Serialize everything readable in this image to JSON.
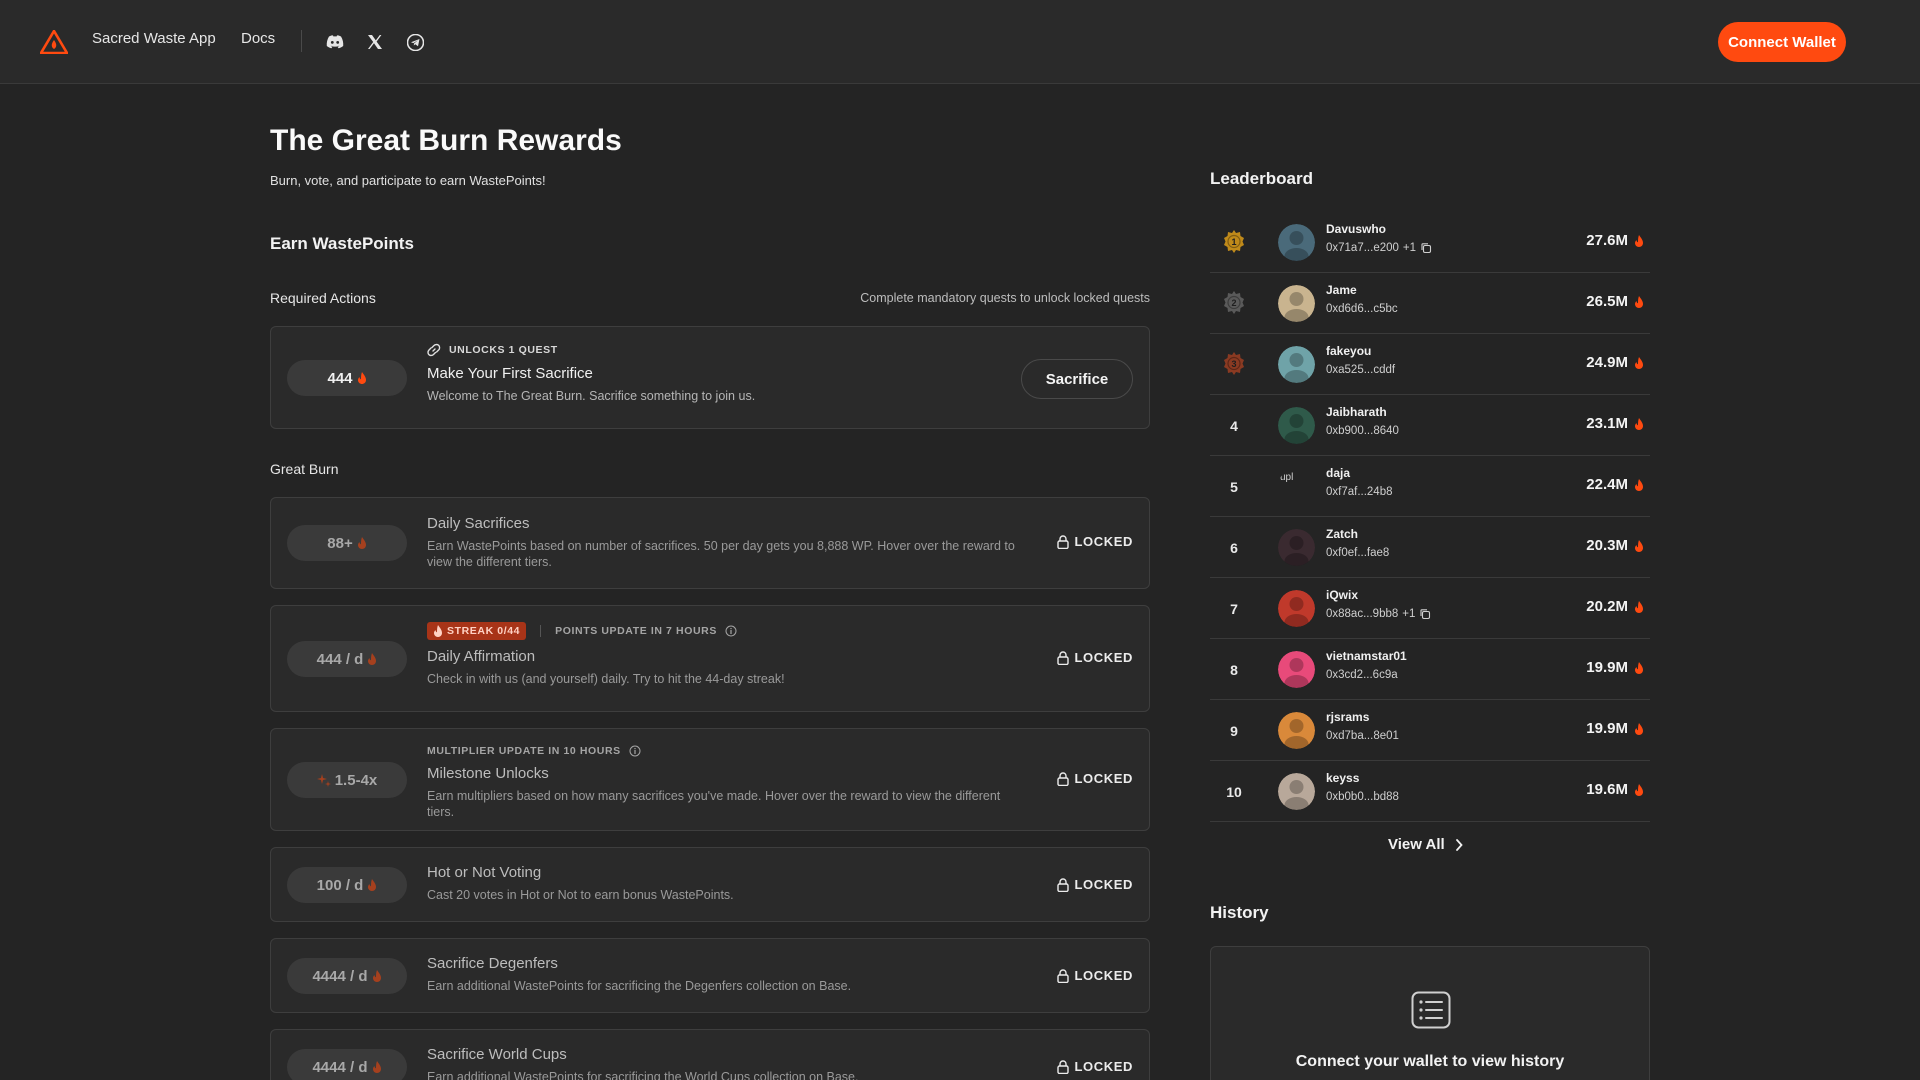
{
  "header": {
    "app_link": "Sacred Waste App",
    "docs_link": "Docs",
    "connect_label": "Connect Wallet",
    "accent": "#ff4a10"
  },
  "main": {
    "title": "The Great Burn Rewards",
    "subtitle": "Burn, vote, and participate to earn WastePoints!",
    "section_title": "Earn WastePoints",
    "required": {
      "label": "Required Actions",
      "note": "Complete mandatory quests to unlock locked quests",
      "quest": {
        "reward": "444",
        "unlocks": "UNLOCKS 1 QUEST",
        "title": "Make Your First Sacrifice",
        "desc": "Welcome to The Great Burn. Sacrifice something to join us.",
        "button": "Sacrifice"
      }
    },
    "great_burn": {
      "label": "Great Burn",
      "locked_label": "LOCKED",
      "quests": [
        {
          "reward": "88+",
          "title": "Daily Sacrifices",
          "desc": "Earn WastePoints based on number of sacrifices. 50 per day gets you 8,888 WP. Hover over the reward to view the different tiers."
        },
        {
          "reward": "444 / d",
          "streak": "STREAK 0/44",
          "update": "POINTS UPDATE IN 7 HOURS",
          "title": "Daily Affirmation",
          "desc": "Check in with us (and yourself) daily. Try to hit the 44-day streak!"
        },
        {
          "reward": "1.5-4x",
          "update": "MULTIPLIER UPDATE IN 10 HOURS",
          "title": "Milestone Unlocks",
          "desc": "Earn multipliers based on how many sacrifices you've made. Hover over the reward to view the different tiers."
        },
        {
          "reward": "100 / d",
          "title": "Hot or Not Voting",
          "desc": "Cast 20 votes in Hot or Not to earn bonus WastePoints."
        },
        {
          "reward": "4444 / d",
          "title": "Sacrifice Degenfers",
          "desc": "Earn additional WastePoints for sacrificing the Degenfers collection on Base."
        },
        {
          "reward": "4444 / d",
          "title": "Sacrifice World Cups",
          "desc": "Earn additional WastePoints for sacrificing the World Cups collection on Base."
        }
      ]
    }
  },
  "leaderboard": {
    "title": "Leaderboard",
    "view_all": "View All",
    "rows": [
      {
        "rank": "1",
        "name": "Davuswho",
        "addr": "0x71a7...e200",
        "extra": "+1",
        "score": "27.6M",
        "avatar_color": "#4a6a7a"
      },
      {
        "rank": "2",
        "name": "Jame",
        "addr": "0xd6d6...c5bc",
        "extra": "",
        "score": "26.5M",
        "avatar_color": "#c9b48f"
      },
      {
        "rank": "3",
        "name": "fakeyou",
        "addr": "0xa525...cddf",
        "extra": "",
        "score": "24.9M",
        "avatar_color": "#6fa3a8"
      },
      {
        "rank": "4",
        "name": "Jaibharath",
        "addr": "0xb900...8640",
        "extra": "",
        "score": "23.1M",
        "avatar_color": "#2f5a4a"
      },
      {
        "rank": "5",
        "name": "daja",
        "addr": "0xf7af...24b8",
        "extra": "",
        "score": "22.4M",
        "avatar_color": "#2a2a2a",
        "broken": "upl"
      },
      {
        "rank": "6",
        "name": "Zatch",
        "addr": "0xf0ef...fae8",
        "extra": "",
        "score": "20.3M",
        "avatar_color": "#3a2a30"
      },
      {
        "rank": "7",
        "name": "iQwix",
        "addr": "0x88ac...9bb8",
        "extra": "+1",
        "score": "20.2M",
        "avatar_color": "#c0392b"
      },
      {
        "rank": "8",
        "name": "vietnamstar01",
        "addr": "0x3cd2...6c9a",
        "extra": "",
        "score": "19.9M",
        "avatar_color": "#e84a7a"
      },
      {
        "rank": "9",
        "name": "rjsrams",
        "addr": "0xd7ba...8e01",
        "extra": "",
        "score": "19.9M",
        "avatar_color": "#d9893a"
      },
      {
        "rank": "10",
        "name": "keyss",
        "addr": "0xb0b0...bd88",
        "extra": "",
        "score": "19.6M",
        "avatar_color": "#b8a89a"
      }
    ]
  },
  "history": {
    "title": "History",
    "empty_text": "Connect your wallet to view history"
  }
}
